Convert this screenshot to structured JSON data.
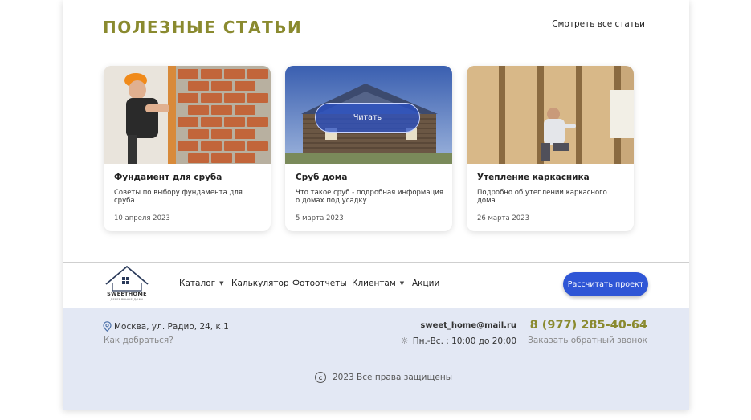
{
  "section": {
    "title": "ПОЛЕЗНЫЕ СТАТЬИ",
    "all_articles_link": "Смотреть все статьи"
  },
  "articles": [
    {
      "title": "Фундамент для сруба",
      "description": "Советы по выбору фундамента для сруба",
      "date": "10 апреля 2023"
    },
    {
      "title": "Сруб дома",
      "description": "Что такое сруб - подробная информация о домах под усадку",
      "date": "5 марта 2023",
      "read_label": "Читать"
    },
    {
      "title": "Утепление каркасника",
      "description": "Подробно об утеплении каркасного дома",
      "date": "26 марта 2023"
    }
  ],
  "header": {
    "logo_text": "SWEETHOME",
    "logo_subtext": "ДЕРЕВЯННЫЕ ДОМА",
    "nav": [
      {
        "label": "Каталог",
        "has_dropdown": true
      },
      {
        "label": "Калькулятор"
      },
      {
        "label": "Фотоотчеты"
      },
      {
        "label": "Клиентам",
        "has_dropdown": true
      },
      {
        "label": "Акции"
      }
    ],
    "cta_label": "Рассчитать проект"
  },
  "footer": {
    "address": "Москва, ул. Радио, 24, к.1",
    "directions_link": "Как добраться?",
    "email": "sweet_home@mail.ru",
    "hours": "Пн.-Вс. : 10:00 до 20:00",
    "phone": "8 (977) 285-40-64",
    "callback_link": "Заказать обратный звонок",
    "copyright": "2023 Все права защищены"
  },
  "colors": {
    "accent_olive": "#8a8a2f",
    "button_blue": "#2f56d6",
    "footer_bg": "#e3e8f4"
  }
}
